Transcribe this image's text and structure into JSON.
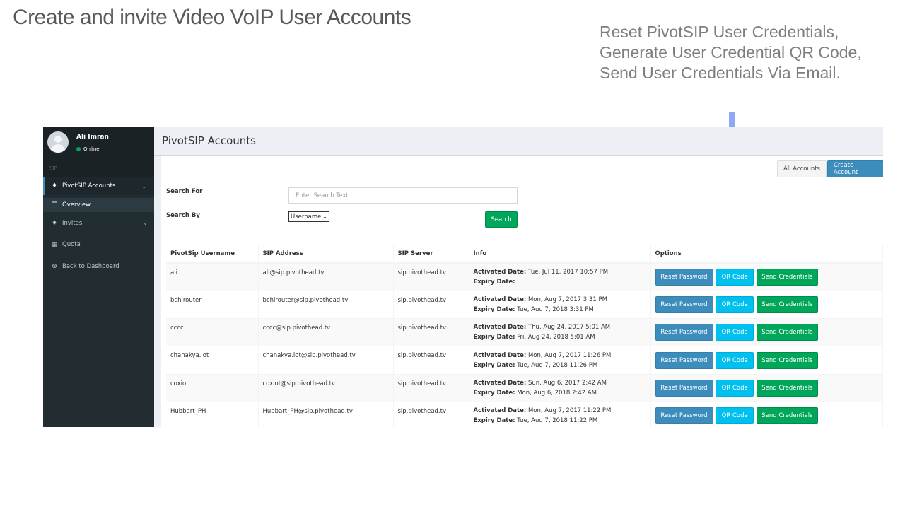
{
  "slide": {
    "title": "Create and invite Video VoIP User Accounts",
    "callout": [
      "Reset PivotSIP User Credentials,",
      "Generate User Credential QR Code,",
      "Send User Credentials Via Email."
    ],
    "arrow_color": "#8fa8f5"
  },
  "sidebar": {
    "user_name": "Ali Imran",
    "user_status": "Online",
    "section_header": "SIP",
    "items": [
      {
        "label": "PivotSIP Accounts",
        "icon": "bell-icon"
      },
      {
        "label": "Overview",
        "icon": "list-icon"
      },
      {
        "label": "Invites",
        "icon": "bell-icon"
      },
      {
        "label": "Quota",
        "icon": "calculator-icon"
      },
      {
        "label": "Back to Dashboard",
        "icon": "circle-arrow-icon"
      }
    ]
  },
  "header": {
    "title": "PivotSIP Accounts"
  },
  "toolbar": {
    "all_accounts_label": "All Accounts",
    "create_account_label": "Create Account"
  },
  "search": {
    "search_for_label": "Search For",
    "placeholder": "Enter Search Text",
    "search_by_label": "Search By",
    "search_by_value": "Username",
    "search_button_label": "Search"
  },
  "table": {
    "headers": [
      "PivotSip Username",
      "SIP Address",
      "SIP Server",
      "Info",
      "Options"
    ],
    "activated_label": "Activated Date:",
    "expiry_label": "Expiry Date:",
    "button_labels": {
      "reset": "Reset Password",
      "qr": "QR Code",
      "send": "Send Credentials"
    },
    "rows": [
      {
        "username": "ali",
        "address": "ali@sip.pivothead.tv",
        "server": "sip.pivothead.tv",
        "activated": "Tue, Jul 11, 2017 10:57 PM",
        "expiry": ""
      },
      {
        "username": "bchirouter",
        "address": "bchirouter@sip.pivothead.tv",
        "server": "sip.pivothead.tv",
        "activated": "Mon, Aug 7, 2017 3:31 PM",
        "expiry": "Tue, Aug 7, 2018 3:31 PM"
      },
      {
        "username": "cccc",
        "address": "cccc@sip.pivothead.tv",
        "server": "sip.pivothead.tv",
        "activated": "Thu, Aug 24, 2017 5:01 AM",
        "expiry": "Fri, Aug 24, 2018 5:01 AM"
      },
      {
        "username": "chanakya.iot",
        "address": "chanakya.iot@sip.pivothead.tv",
        "server": "sip.pivothead.tv",
        "activated": "Mon, Aug 7, 2017 11:26 PM",
        "expiry": "Tue, Aug 7, 2018 11:26 PM"
      },
      {
        "username": "coxiot",
        "address": "coxiot@sip.pivothead.tv",
        "server": "sip.pivothead.tv",
        "activated": "Sun, Aug 6, 2017 2:42 AM",
        "expiry": "Mon, Aug 6, 2018 2:42 AM"
      },
      {
        "username": "Hubbart_PH",
        "address": "Hubbart_PH@sip.pivothead.tv",
        "server": "sip.pivothead.tv",
        "activated": "Mon, Aug 7, 2017 11:22 PM",
        "expiry": "Tue, Aug 7, 2018 11:22 PM"
      }
    ]
  },
  "colors": {
    "primary": "#3c8dbc",
    "success": "#00a65a",
    "info": "#00c0ef",
    "sidebar_bg": "#222d32"
  }
}
